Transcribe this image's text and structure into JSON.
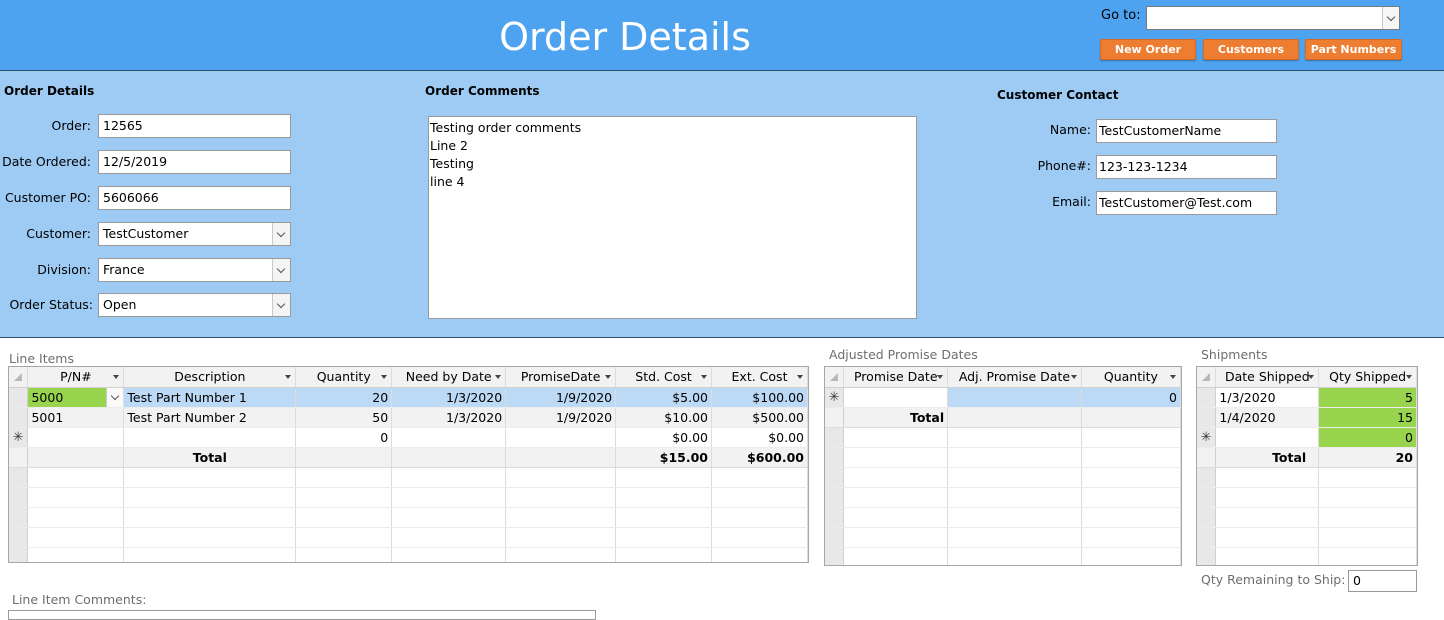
{
  "header": {
    "title": "Order Details",
    "goto_label": "Go to:",
    "goto_value": "",
    "buttons": {
      "new_order": "New Order",
      "customers": "Customers",
      "part_numbers": "Part Numbers"
    },
    "color": "#4da3ef",
    "button_color": "#ed7d31"
  },
  "order_details": {
    "title": "Order Details",
    "order_label": "Order:",
    "order_value": "12565",
    "date_label": "Date Ordered:",
    "date_value": "12/5/2019",
    "po_label": "Customer PO:",
    "po_value": "5606066",
    "customer_label": "Customer:",
    "customer_value": "TestCustomer",
    "division_label": "Division:",
    "division_value": "France",
    "status_label": "Order Status:",
    "status_value": "Open"
  },
  "order_comments": {
    "title": "Order Comments",
    "lines": [
      "Testing order comments",
      "Line 2",
      "Testing",
      "line 4"
    ]
  },
  "customer_contact": {
    "title": "Customer Contact",
    "name_label": "Name:",
    "name_value": "TestCustomerName",
    "phone_label": "Phone#:",
    "phone_value": "123-123-1234",
    "email_label": "Email:",
    "email_value": "TestCustomer@Test.com"
  },
  "line_items": {
    "caption": "Line Items",
    "columns": [
      "P/N#",
      "Description",
      "Quantity",
      "Need by Date",
      "PromiseDate",
      "Std. Cost",
      "Ext. Cost"
    ],
    "rows": [
      [
        "5000",
        "Test Part Number 1",
        "20",
        "1/3/2020",
        "1/9/2020",
        "$5.00",
        "$100.00"
      ],
      [
        "5001",
        "Test Part Number 2",
        "50",
        "1/3/2020",
        "1/9/2020",
        "$10.00",
        "$500.00"
      ]
    ],
    "new_row": {
      "quantity": "0",
      "std_cost": "$0.00",
      "ext_cost": "$0.00"
    },
    "total": {
      "label": "Total",
      "std_cost": "$15.00",
      "ext_cost": "$600.00"
    }
  },
  "adjusted_promise": {
    "caption": "Adjusted Promise Dates",
    "columns": [
      "Promise Date",
      "Adj. Promise Date",
      "Quantity"
    ],
    "new_row_quantity": "0",
    "total_label": "Total"
  },
  "shipments": {
    "caption": "Shipments",
    "columns": [
      "Date Shipped",
      "Qty Shipped"
    ],
    "rows": [
      [
        "1/3/2020",
        "5"
      ],
      [
        "1/4/2020",
        "15"
      ]
    ],
    "new_row_qty": "0",
    "total": {
      "label": "Total",
      "value": "20"
    },
    "highlight_color": "#99d44f"
  },
  "qty_remaining": {
    "label": "Qty Remaining to Ship:",
    "value": "0"
  },
  "line_item_comments": {
    "label": "Line Item Comments:"
  }
}
